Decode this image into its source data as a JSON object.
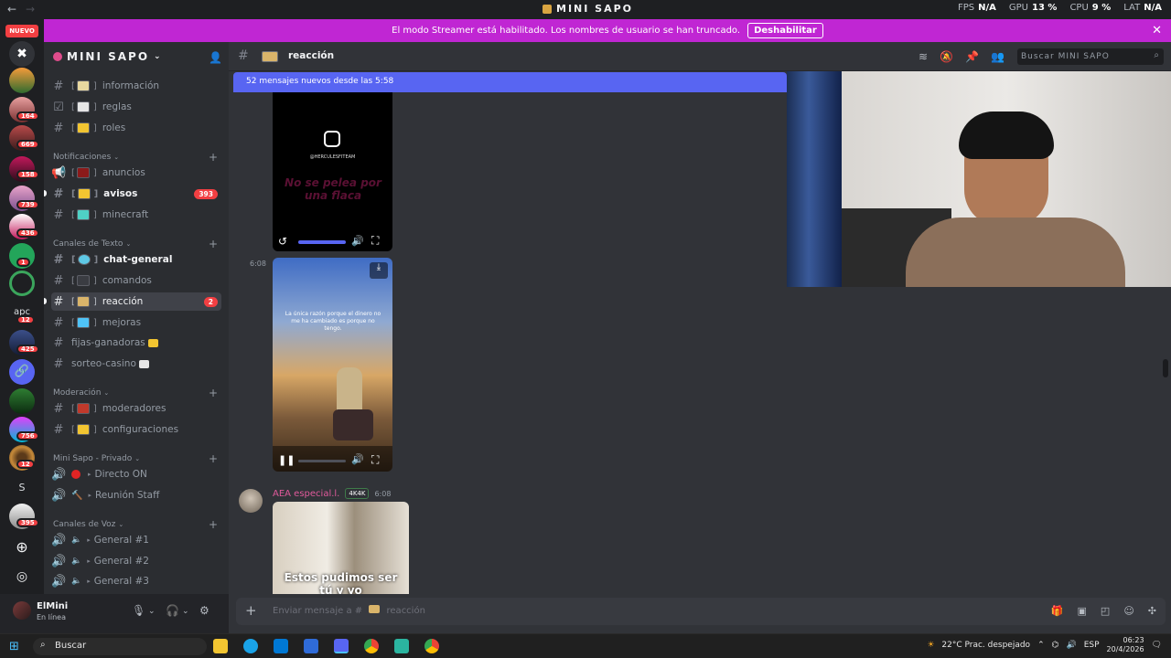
{
  "titlebar": {
    "title": "MINI SAPO",
    "fps_label": "FPS",
    "fps_value": "N/A",
    "gpu_label": "GPU",
    "gpu_value": "13 %",
    "cpu_label": "CPU",
    "cpu_value": "9 %",
    "lat_label": "LAT",
    "lat_value": "N/A"
  },
  "banner": {
    "text": "El modo Streamer está habilitado. Los nombres de usuario se han truncado.",
    "button": "Deshabilitar"
  },
  "rail": {
    "nuevo": "NUEVO",
    "badges": [
      "164",
      "669",
      "158",
      "739",
      "436",
      "1",
      "12",
      "425",
      "756",
      "12",
      "395"
    ],
    "text_server": "S",
    "apc_label": "apc"
  },
  "server": {
    "name": "MINI SAPO"
  },
  "channels": {
    "top": [
      {
        "name": "información"
      },
      {
        "name": "reglas"
      },
      {
        "name": "roles"
      }
    ],
    "cat_notif": "Notificaciones",
    "notif": [
      {
        "name": "anuncios"
      },
      {
        "name": "avisos",
        "badge": "393"
      },
      {
        "name": "minecraft"
      }
    ],
    "cat_text": "Canales de Texto",
    "text": [
      {
        "name": "chat-general"
      },
      {
        "name": "comandos"
      },
      {
        "name": "reacción",
        "badge": "2"
      },
      {
        "name": "mejoras"
      },
      {
        "name": "fijas-ganadoras"
      },
      {
        "name": "sorteo-casino"
      }
    ],
    "cat_mod": "Moderación",
    "mod": [
      {
        "name": "moderadores"
      },
      {
        "name": "configuraciones"
      }
    ],
    "cat_priv": "Mini Sapo - Privado",
    "priv": [
      {
        "name": "Directo ON"
      },
      {
        "name": "Reunión Staff"
      }
    ],
    "cat_voice": "Canales de Voz",
    "voice": [
      {
        "name": "General #1"
      },
      {
        "name": "General #2"
      },
      {
        "name": "General #3"
      }
    ]
  },
  "user": {
    "name": "ElMini",
    "status": "En línea"
  },
  "header": {
    "channel": "reacción",
    "search_placeholder": "Buscar MINI SAPO"
  },
  "messages": {
    "new_bar": "52 mensajes nuevos desde las 5:58",
    "video1": {
      "handle": "@HERCULESFITEAM",
      "overlay": "No se pelea por una flaca"
    },
    "time2": "6:08",
    "video2": {
      "caption": "La única razón porque el dinero no me ha cambiado es porque no tengo."
    },
    "author": "AEA especial.l.",
    "author_badge": "4K4K",
    "author_time": "6:08",
    "video3": {
      "caption": "Estos pudimos ser tú y yo"
    }
  },
  "composer": {
    "placeholder": "Enviar mensaje a #",
    "channel": "reacción"
  },
  "taskbar": {
    "search": "Buscar",
    "weather": "22°C  Prac. despejado",
    "lang": "ESP",
    "time": "06:23",
    "date": "20/4/2026"
  }
}
